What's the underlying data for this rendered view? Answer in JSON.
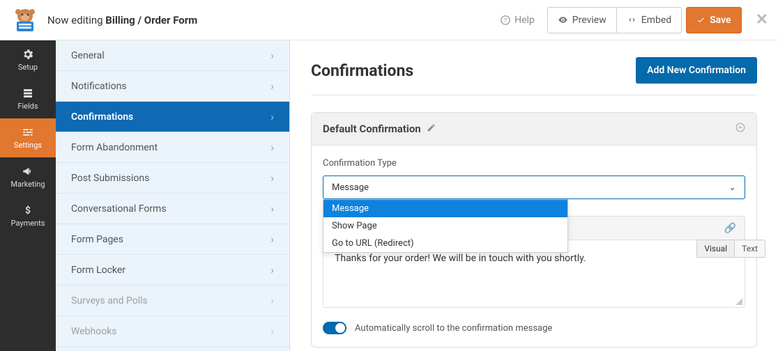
{
  "topbar": {
    "editing_prefix": "Now editing ",
    "form_name": "Billing / Order Form",
    "help": "Help",
    "preview": "Preview",
    "embed": "Embed",
    "save": "Save"
  },
  "rail": [
    {
      "id": "setup",
      "label": "Setup"
    },
    {
      "id": "fields",
      "label": "Fields"
    },
    {
      "id": "settings",
      "label": "Settings",
      "active": true
    },
    {
      "id": "marketing",
      "label": "Marketing"
    },
    {
      "id": "payments",
      "label": "Payments"
    }
  ],
  "sidebar": [
    {
      "label": "General"
    },
    {
      "label": "Notifications"
    },
    {
      "label": "Confirmations",
      "active": true
    },
    {
      "label": "Form Abandonment"
    },
    {
      "label": "Post Submissions"
    },
    {
      "label": "Conversational Forms"
    },
    {
      "label": "Form Pages"
    },
    {
      "label": "Form Locker"
    },
    {
      "label": "Surveys and Polls",
      "disabled": true
    },
    {
      "label": "Webhooks",
      "disabled": true
    }
  ],
  "page": {
    "title": "Confirmations",
    "add_button": "Add New Confirmation"
  },
  "panel": {
    "title": "Default Confirmation",
    "type_label": "Confirmation Type",
    "selected": "Message",
    "options": [
      "Message",
      "Show Page",
      "Go to URL (Redirect)"
    ],
    "tabs": {
      "visual": "Visual",
      "text": "Text"
    },
    "message": "Thanks for your order! We will be in touch with you shortly.",
    "scroll_label": "Automatically scroll to the confirmation message"
  }
}
